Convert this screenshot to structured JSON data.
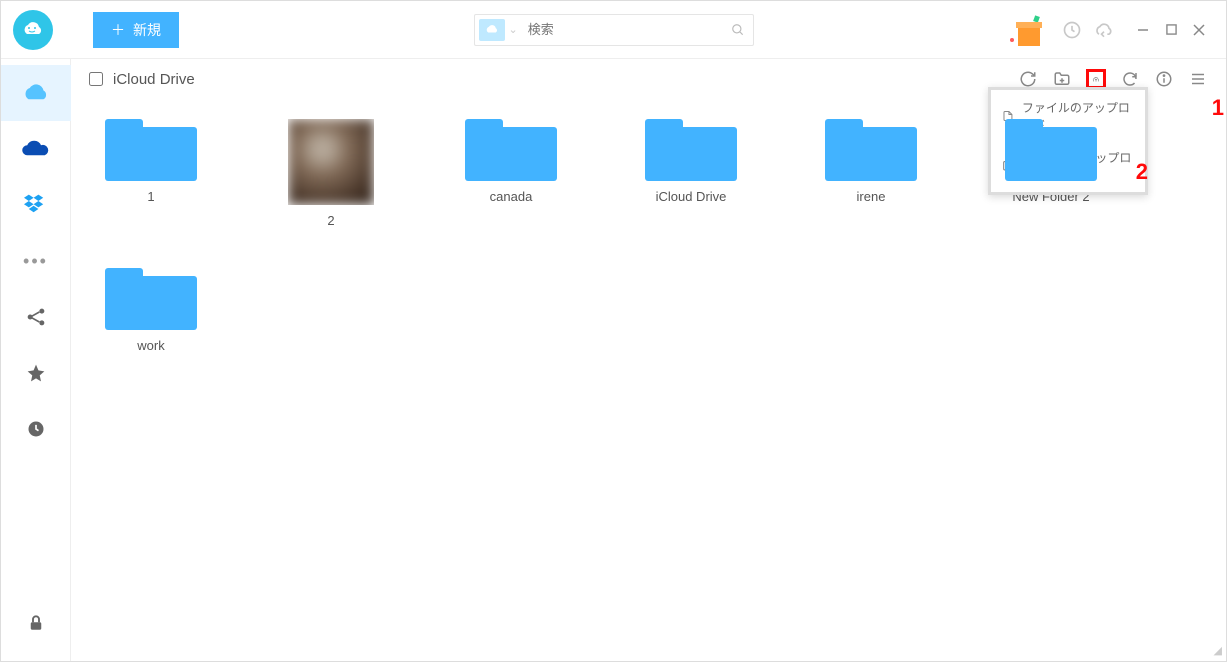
{
  "topbar": {
    "new_button": "新規",
    "search_placeholder": "検索"
  },
  "sidebar": {
    "items": [
      "icloud",
      "onedrive",
      "dropbox",
      "more",
      "share",
      "star",
      "clock"
    ],
    "lock": "lock"
  },
  "pathbar": {
    "title": "iCloud Drive"
  },
  "upload_menu": {
    "file": "ファイルのアップロード",
    "folder": "フォルダのアップロード"
  },
  "items": [
    {
      "label": "1",
      "type": "folder"
    },
    {
      "label": "2",
      "type": "image"
    },
    {
      "label": "canada",
      "type": "folder"
    },
    {
      "label": "iCloud Drive",
      "type": "folder"
    },
    {
      "label": "irene",
      "type": "folder"
    },
    {
      "label": "New Folder 2",
      "type": "folder"
    },
    {
      "label": "work",
      "type": "folder"
    }
  ],
  "annot": {
    "a1": "1",
    "a2": "2"
  }
}
